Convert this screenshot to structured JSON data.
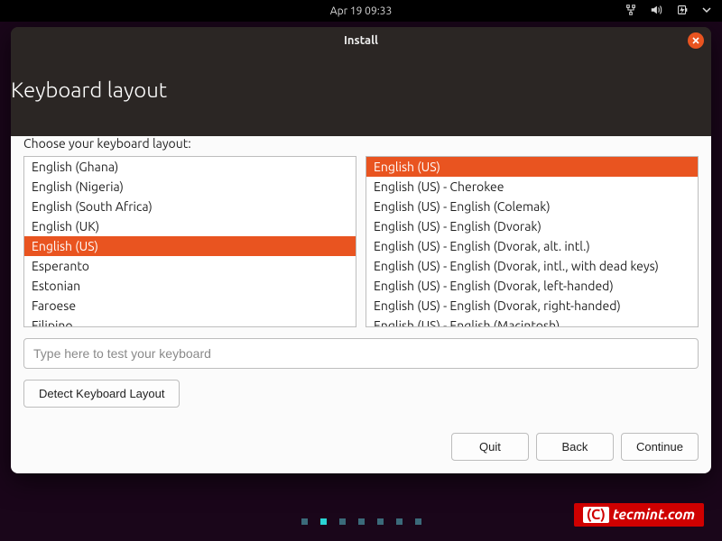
{
  "menubar": {
    "clock": "Apr 19  09:33"
  },
  "window": {
    "title": "Install"
  },
  "page": {
    "heading": "Keyboard layout",
    "choose_label": "Choose your keyboard layout:"
  },
  "layouts": {
    "items": [
      "English (Ghana)",
      "English (Nigeria)",
      "English (South Africa)",
      "English (UK)",
      "English (US)",
      "Esperanto",
      "Estonian",
      "Faroese",
      "Filipino"
    ],
    "selected_index": 4
  },
  "variants": {
    "items": [
      "English (US)",
      "English (US) - Cherokee",
      "English (US) - English (Colemak)",
      "English (US) - English (Dvorak)",
      "English (US) - English (Dvorak, alt. intl.)",
      "English (US) - English (Dvorak, intl., with dead keys)",
      "English (US) - English (Dvorak, left-handed)",
      "English (US) - English (Dvorak, right-handed)",
      "English (US) - English (Macintosh)"
    ],
    "selected_index": 0
  },
  "test_input": {
    "placeholder": "Type here to test your keyboard",
    "value": ""
  },
  "buttons": {
    "detect": "Detect Keyboard Layout",
    "quit": "Quit",
    "back": "Back",
    "continue": "Continue"
  },
  "progress": {
    "total": 7,
    "current": 1
  },
  "watermark": {
    "badge": "(C)",
    "text": "tecmint.com"
  }
}
